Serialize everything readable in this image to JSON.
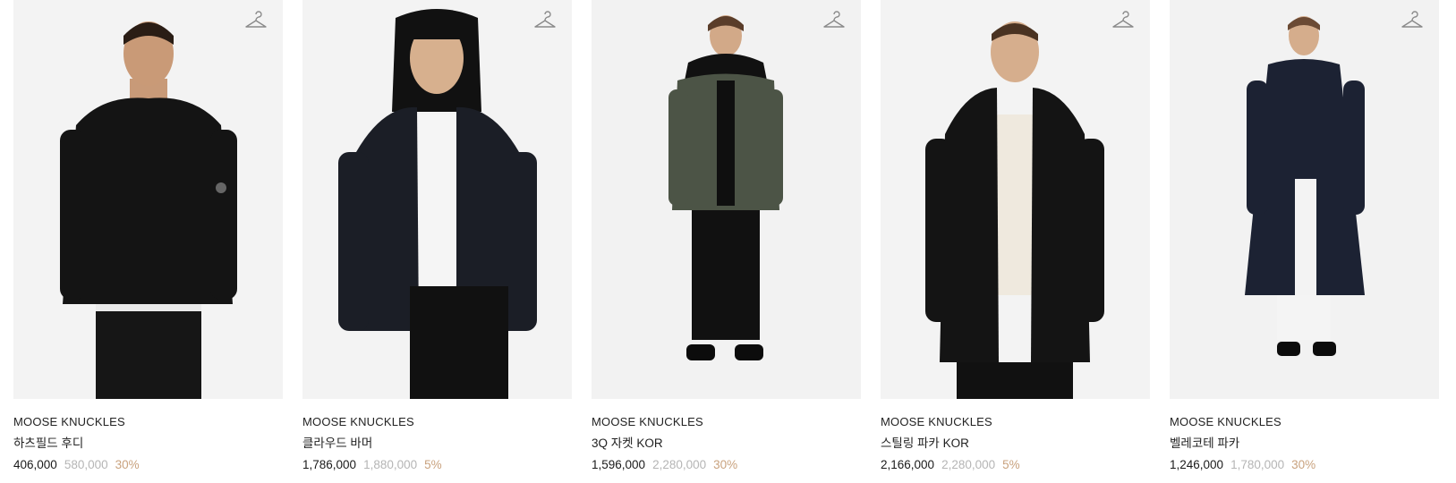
{
  "colors": {
    "image_bg": "#f2f2f2",
    "original_price": "#b5b5b5",
    "discount": "#c9a27e"
  },
  "icons": {
    "wishlist": "hanger-icon"
  },
  "products": [
    {
      "brand": "MOOSE KNUCKLES",
      "name": "하츠필드 후디",
      "price": "406,000",
      "original_price": "580,000",
      "discount": "30%"
    },
    {
      "brand": "MOOSE KNUCKLES",
      "name": "클라우드 바머",
      "price": "1,786,000",
      "original_price": "1,880,000",
      "discount": "5%"
    },
    {
      "brand": "MOOSE KNUCKLES",
      "name": "3Q 자켓 KOR",
      "price": "1,596,000",
      "original_price": "2,280,000",
      "discount": "30%"
    },
    {
      "brand": "MOOSE KNUCKLES",
      "name": "스틸링 파카 KOR",
      "price": "2,166,000",
      "original_price": "2,280,000",
      "discount": "5%"
    },
    {
      "brand": "MOOSE KNUCKLES",
      "name": "벨레코테 파카",
      "price": "1,246,000",
      "original_price": "1,780,000",
      "discount": "30%"
    }
  ]
}
